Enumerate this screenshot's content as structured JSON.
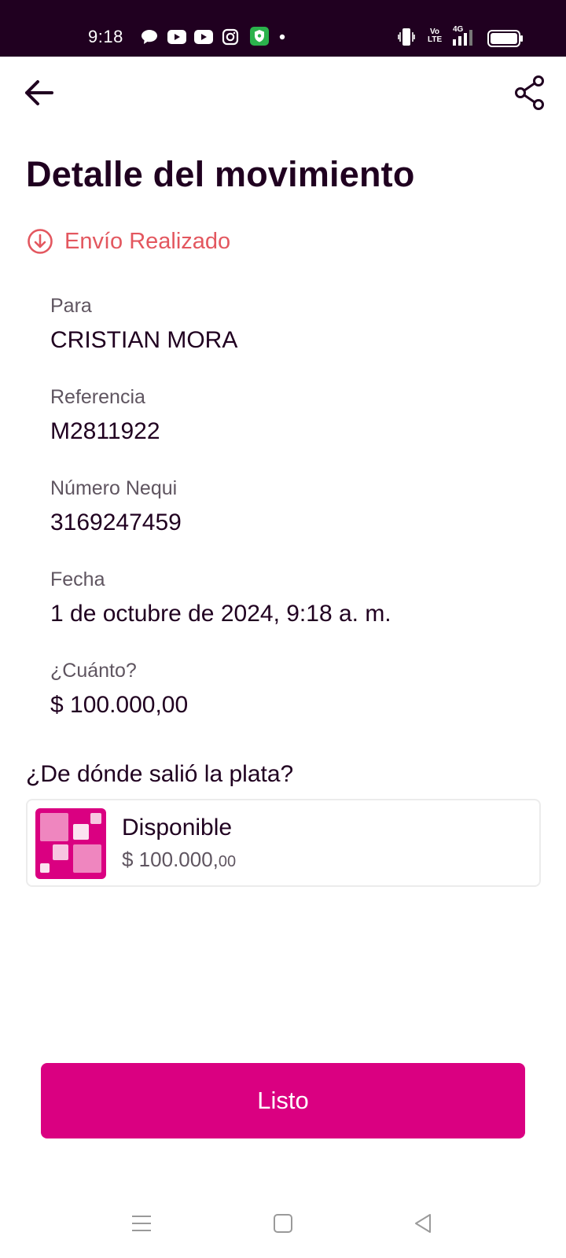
{
  "status_bar": {
    "time": "9:18",
    "notification_icons": [
      "chat-bubble-icon",
      "youtube-icon",
      "youtube-icon",
      "instagram-icon",
      "shield-app-icon",
      "dot-icon"
    ],
    "right_icons": [
      "vibrate-icon",
      "volte-icon",
      "signal-4g-icon",
      "battery-icon"
    ],
    "volte_label": "Vo LTE",
    "network_label": "4G"
  },
  "header": {
    "back_icon": "arrow-left-icon",
    "share_icon": "share-icon"
  },
  "page": {
    "title": "Detalle del movimiento",
    "status_icon": "arrow-down-circle-icon",
    "status_text": "Envío Realizado"
  },
  "details": [
    {
      "label": "Para",
      "value": "CRISTIAN MORA"
    },
    {
      "label": "Referencia",
      "value": "M2811922"
    },
    {
      "label": "Número Nequi",
      "value": "3169247459"
    },
    {
      "label": "Fecha",
      "value": "1 de octubre de 2024, 9:18 a. m."
    },
    {
      "label": "¿Cuánto?",
      "value": "$ 100.000,00"
    }
  ],
  "source": {
    "title": "¿De dónde salió la plata?",
    "pocket_name": "Disponible",
    "pocket_balance_main": "$ 100.000,",
    "pocket_balance_decimals": "00"
  },
  "actions": {
    "done_label": "Listo"
  },
  "colors": {
    "brand_pink": "#da0081",
    "dark": "#200020",
    "status_red": "#e3575f"
  },
  "navbar": {
    "icons": [
      "menu-icon",
      "home-square-icon",
      "back-triangle-icon"
    ]
  }
}
